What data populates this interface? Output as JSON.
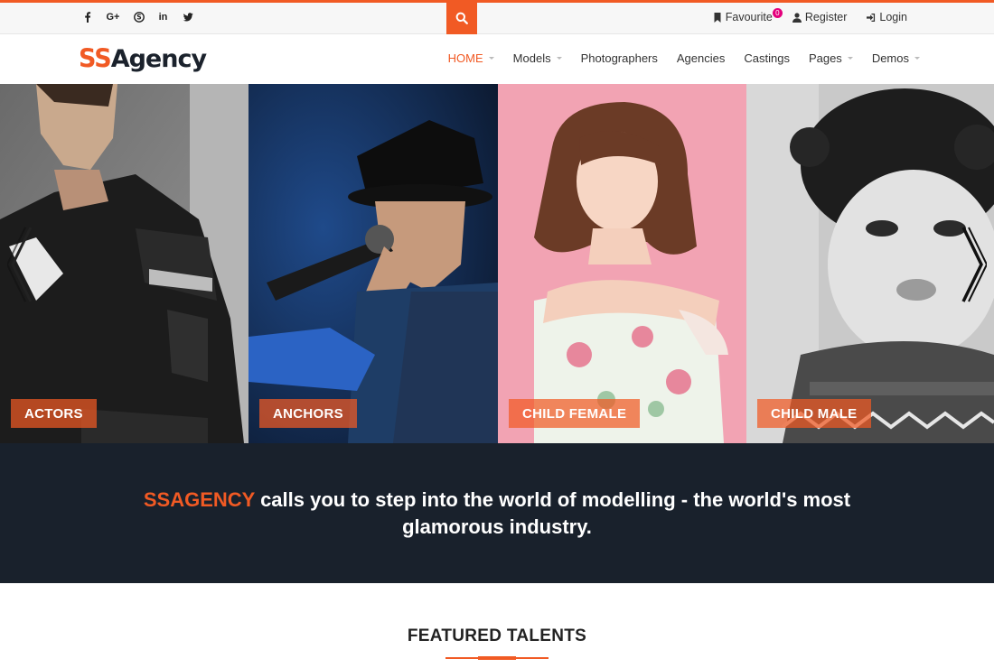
{
  "topbar": {
    "socials": [
      {
        "name": "facebook-icon",
        "glyph": "f"
      },
      {
        "name": "google-plus-icon",
        "glyph": "G+"
      },
      {
        "name": "skype-icon",
        "glyph": "S"
      },
      {
        "name": "linkedin-icon",
        "glyph": "in"
      },
      {
        "name": "twitter-icon",
        "glyph": "t"
      }
    ],
    "favourite_label": "Favourite",
    "favourite_count": "0",
    "register_label": "Register",
    "login_label": "Login"
  },
  "header": {
    "logo_part1": "SS",
    "logo_part2": "Agency",
    "nav": [
      {
        "label": "HOME",
        "active": true,
        "dropdown": true
      },
      {
        "label": "Models",
        "active": false,
        "dropdown": true
      },
      {
        "label": "Photographers",
        "active": false,
        "dropdown": false
      },
      {
        "label": "Agencies",
        "active": false,
        "dropdown": false
      },
      {
        "label": "Castings",
        "active": false,
        "dropdown": false
      },
      {
        "label": "Pages",
        "active": false,
        "dropdown": true
      },
      {
        "label": "Demos",
        "active": false,
        "dropdown": true
      }
    ]
  },
  "slider": {
    "slides": [
      {
        "label": "ACTORS"
      },
      {
        "label": "ANCHORS"
      },
      {
        "label": "CHILD FEMALE"
      },
      {
        "label": "CHILD MALE"
      }
    ]
  },
  "band": {
    "brand": "SSAGENCY",
    "text": " calls you to step into the world of modelling - the world's most glamorous industry."
  },
  "featured": {
    "title": "FEATURED TALENTS"
  },
  "colors": {
    "accent": "#f15a24",
    "dark": "#19212c",
    "badge": "#e4007c"
  }
}
